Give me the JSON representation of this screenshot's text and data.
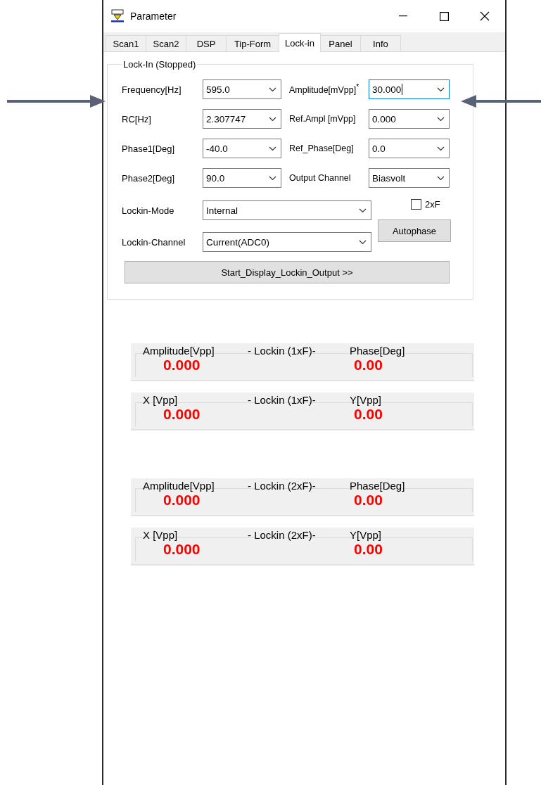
{
  "window": {
    "title": "Parameter"
  },
  "tabs": [
    {
      "label": "Scan1",
      "selected": false
    },
    {
      "label": "Scan2",
      "selected": false
    },
    {
      "label": "DSP",
      "selected": false
    },
    {
      "label": "Tip-Form",
      "selected": false
    },
    {
      "label": "Lock-in",
      "selected": true
    },
    {
      "label": "Panel",
      "selected": false
    },
    {
      "label": "Info",
      "selected": false
    }
  ],
  "group": {
    "title": "Lock-In (Stopped)",
    "fields": [
      {
        "label": "Frequency[Hz]",
        "value": "595.0",
        "focused": false
      },
      {
        "label": "Amplitude[mVpp]$^{*}$",
        "value": "30.000",
        "focused": true
      },
      {
        "label": "RC[Hz]",
        "value": "2.307747",
        "focused": false
      },
      {
        "label": "Ref.Ampl [mVpp]",
        "value": "0.000",
        "focused": false
      },
      {
        "label": "Phase1[Deg]",
        "value": "-40.0",
        "focused": false
      },
      {
        "label": "Ref_Phase[Deg]",
        "value": "0.0",
        "focused": false
      },
      {
        "label": "Phase2[Deg]",
        "value": "90.0",
        "focused": false
      },
      {
        "label": "Output Channel",
        "value": "Biasvolt",
        "focused": false
      }
    ],
    "lockin_mode": {
      "label": "Lockin-Mode",
      "value": "Internal"
    },
    "lockin_channel": {
      "label": "Lockin-Channel",
      "value": "Current(ADC0)"
    },
    "checkbox": {
      "label": "2xF",
      "checked": false
    },
    "autophase_button": "Autophase",
    "start_button": "Start_Display_Lockin_Output  >>"
  },
  "readouts": [
    {
      "left_label": "Amplitude[Vpp]",
      "title": "- Lockin (1xF)-",
      "right_label": "Phase[Deg]",
      "left_value": "0.000",
      "right_value": "0.00"
    },
    {
      "left_label": "X [Vpp]",
      "title": "- Lockin (1xF)-",
      "right_label": "Y[Vpp]",
      "left_value": "0.000",
      "right_value": "0.00"
    },
    {
      "left_label": "Amplitude[Vpp]",
      "title": "- Lockin (2xF)-",
      "right_label": "Phase[Deg]",
      "left_value": "0.000",
      "right_value": "0.00"
    },
    {
      "left_label": "X [Vpp]",
      "title": "- Lockin (2xF)-",
      "right_label": "Y[Vpp]",
      "left_value": "0.000",
      "right_value": "0.00"
    }
  ]
}
